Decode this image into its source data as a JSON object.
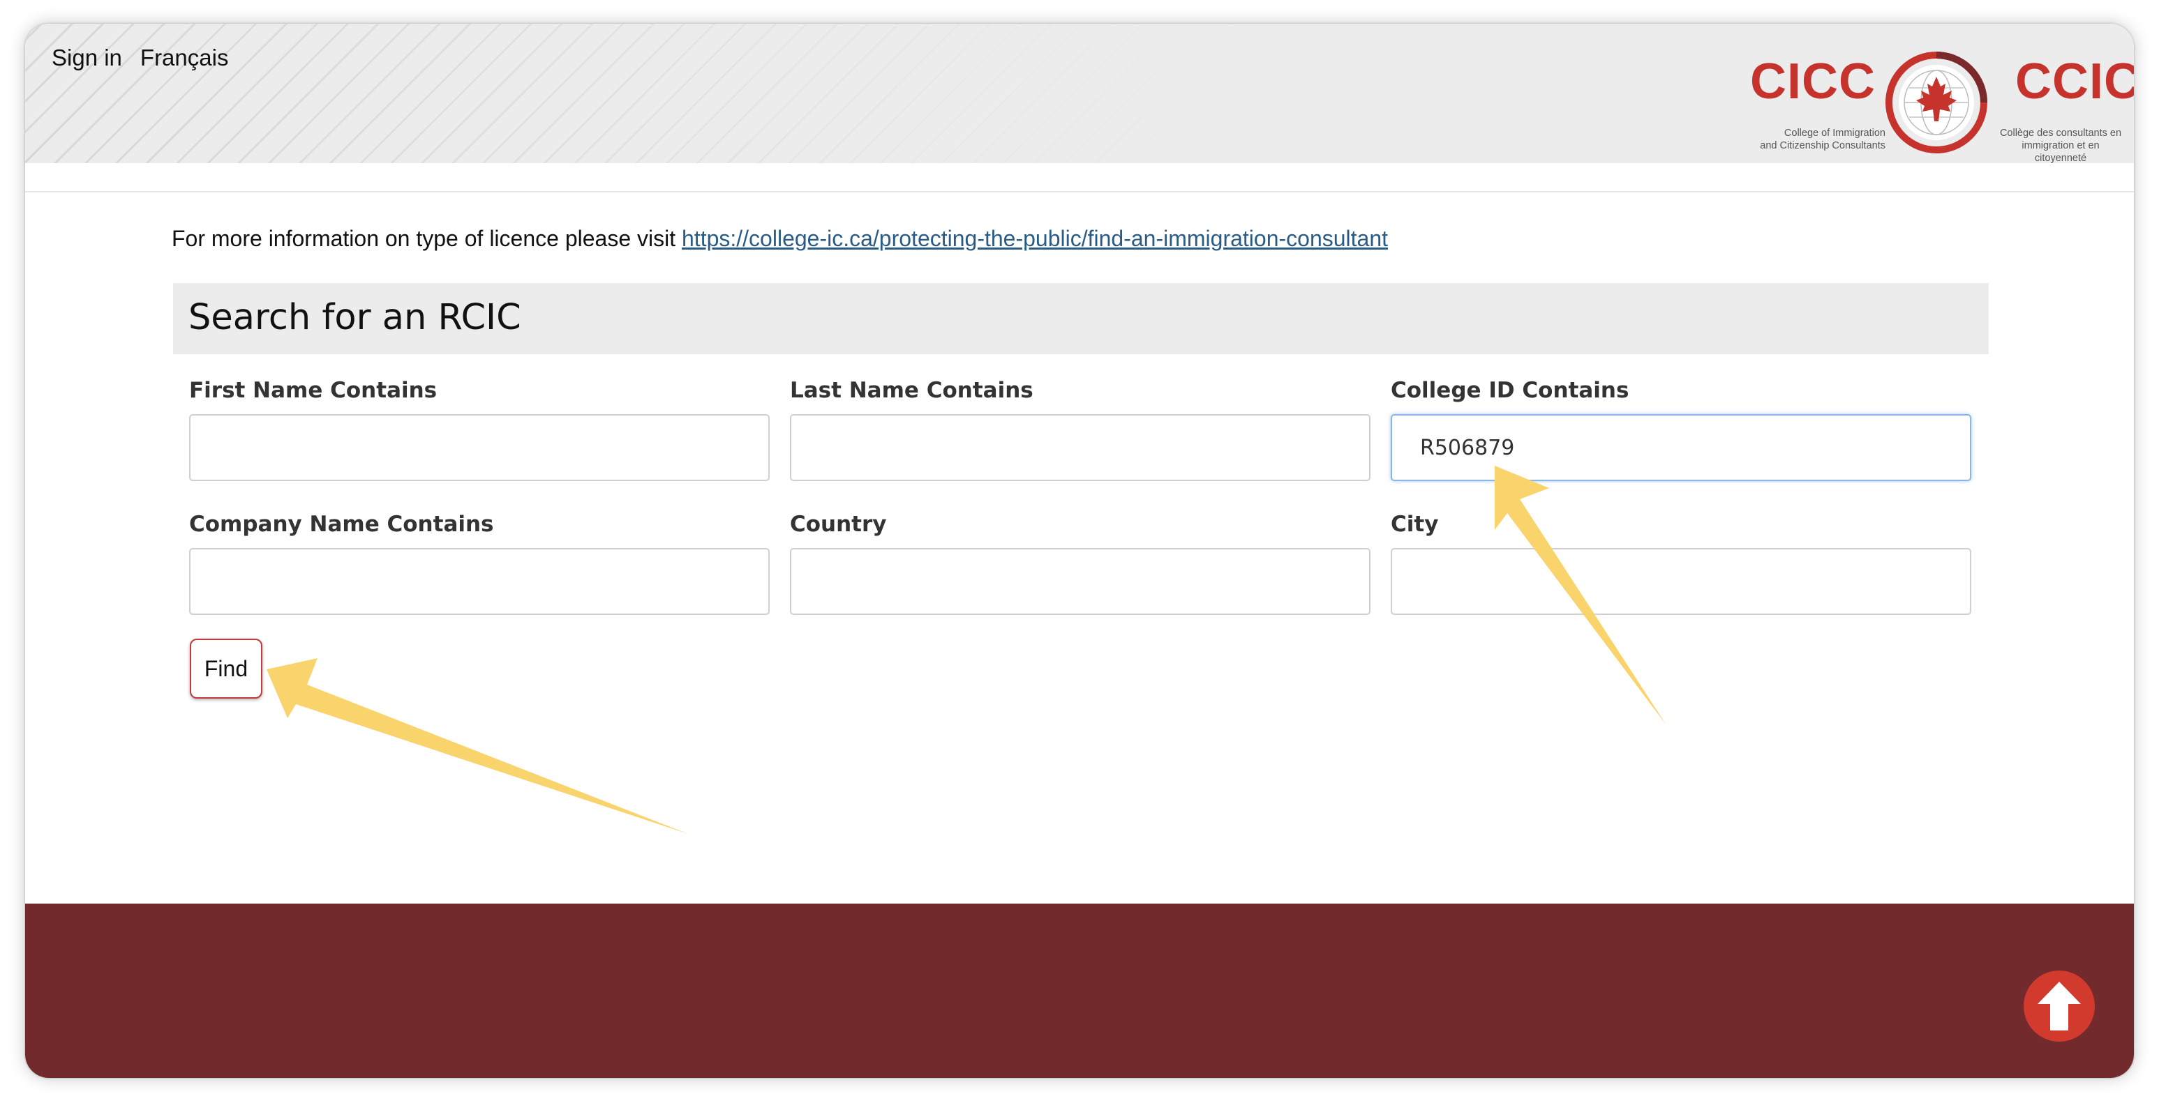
{
  "header": {
    "sign_in": "Sign in",
    "language": "Français",
    "logo": {
      "left_word": "CICC",
      "right_word": "CCIC",
      "left_sub_1": "College of Immigration",
      "left_sub_2": "and Citizenship Consultants",
      "right_sub_1": "Collège des consultants en",
      "right_sub_2": "immigration et en citoyenneté",
      "seal_icon": "maple-leaf-globe-icon"
    }
  },
  "info": {
    "text": "For more information on type of licence please visit ",
    "link": "https://college-ic.ca/protecting-the-public/find-an-immigration-consultant"
  },
  "search": {
    "title": "Search for an RCIC",
    "fields": {
      "first_name": {
        "label": "First Name Contains",
        "value": ""
      },
      "last_name": {
        "label": "Last Name Contains",
        "value": ""
      },
      "college_id": {
        "label": "College ID Contains",
        "value": "R506879"
      },
      "company_name": {
        "label": "Company Name Contains",
        "value": ""
      },
      "country": {
        "label": "Country",
        "value": ""
      },
      "city": {
        "label": "City",
        "value": ""
      }
    },
    "find_label": "Find"
  },
  "footer": {
    "scroll_top_icon": "arrow-up-icon"
  },
  "colors": {
    "brand_red": "#c6332c",
    "footer_maroon": "#722a2c",
    "annotation_yellow": "#f9d36c",
    "link_blue": "#2a5b85"
  }
}
